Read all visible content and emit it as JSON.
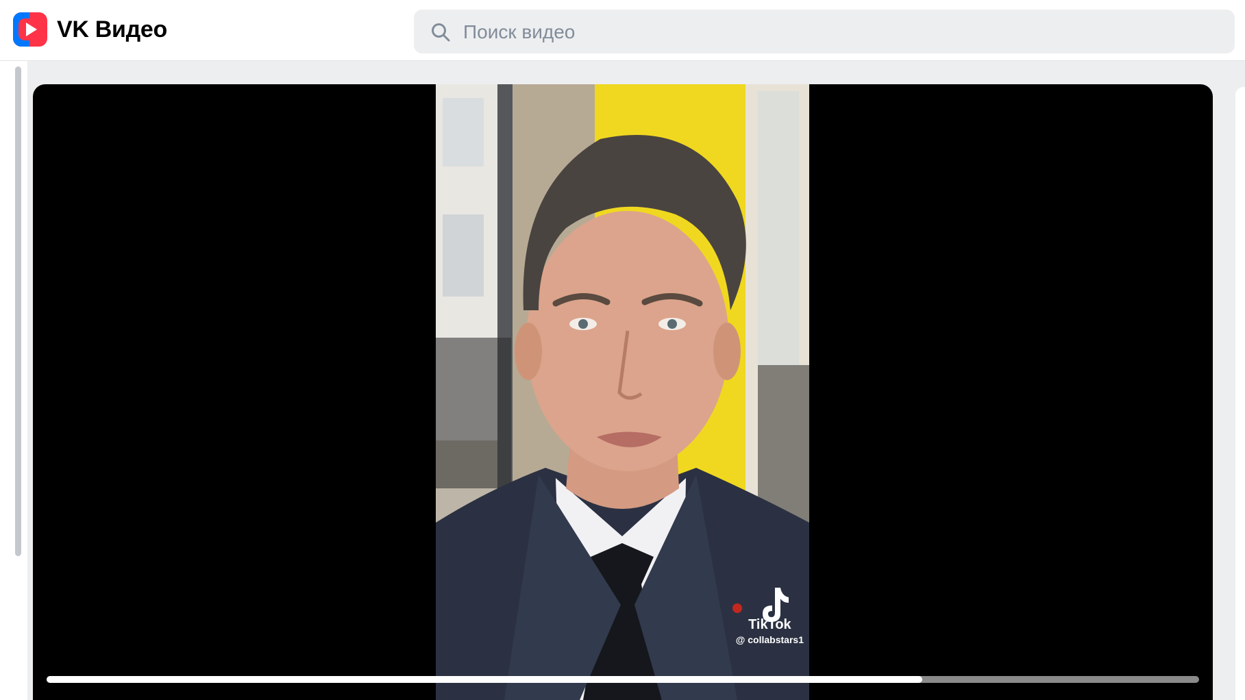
{
  "app": {
    "name": "VK Видео",
    "logo_icon": "vk-video-play-icon"
  },
  "search": {
    "placeholder": "Поиск видео",
    "value": "",
    "icon": "search-icon"
  },
  "player": {
    "watermark": {
      "brand": "TikTok",
      "handle": "@ collabstars1",
      "icon": "tiktok-note-icon"
    },
    "progress_fraction": 0.76
  },
  "colors": {
    "brand_red": "#ff3347",
    "brand_blue": "#0077ff",
    "page_bg": "#edeef0"
  }
}
